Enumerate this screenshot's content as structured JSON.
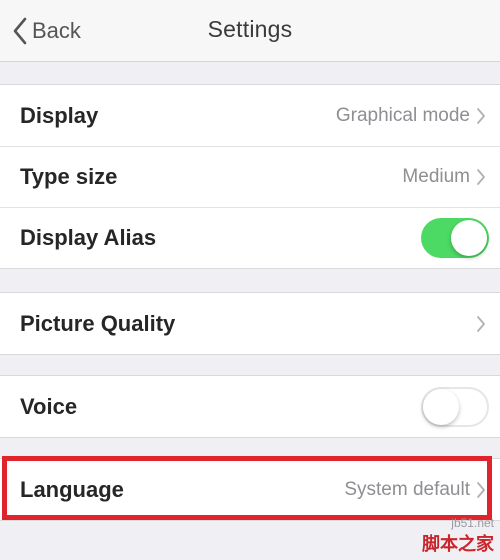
{
  "header": {
    "back_label": "Back",
    "title": "Settings"
  },
  "groups": [
    {
      "rows": [
        {
          "label": "Display",
          "value": "Graphical mode"
        },
        {
          "label": "Type size",
          "value": "Medium"
        },
        {
          "label": "Display Alias",
          "toggle": "on"
        }
      ]
    },
    {
      "rows": [
        {
          "label": "Picture Quality",
          "value": ""
        }
      ]
    },
    {
      "rows": [
        {
          "label": "Voice",
          "toggle": "off"
        }
      ]
    },
    {
      "rows": [
        {
          "label": "Language",
          "value": "System default"
        }
      ]
    }
  ],
  "colors": {
    "toggle_on": "#4cd964",
    "highlight_border": "#e0242e",
    "background": "#efeff4"
  },
  "watermark": {
    "url": "jb51.net",
    "brand": "脚本之家"
  }
}
